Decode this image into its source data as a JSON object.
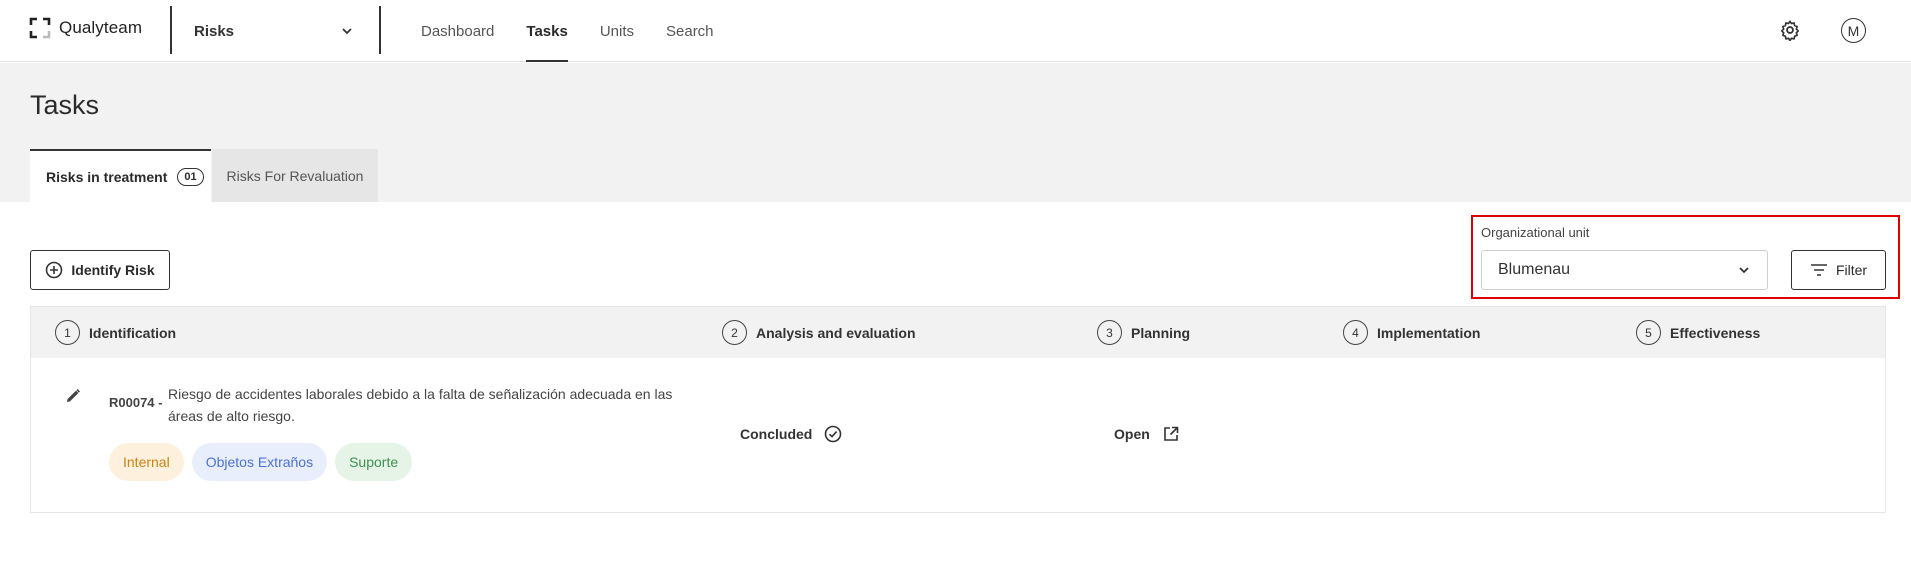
{
  "app": {
    "name": "Qualyteam"
  },
  "module_select": {
    "value": "Risks"
  },
  "nav": [
    {
      "label": "Dashboard",
      "active": false
    },
    {
      "label": "Tasks",
      "active": true
    },
    {
      "label": "Units",
      "active": false
    },
    {
      "label": "Search",
      "active": false
    }
  ],
  "user": {
    "initial": "M"
  },
  "page": {
    "title": "Tasks"
  },
  "tabs": [
    {
      "label": "Risks in treatment",
      "count": "01",
      "active": true
    },
    {
      "label": "Risks For Revaluation",
      "active": false
    }
  ],
  "toolbar": {
    "identify_label": "Identify Risk",
    "org_unit_label": "Organizational unit",
    "org_unit_value": "Blumenau",
    "filter_label": "Filter"
  },
  "table": {
    "columns": [
      {
        "step": "1",
        "label": "Identification"
      },
      {
        "step": "2",
        "label": "Analysis and evaluation"
      },
      {
        "step": "3",
        "label": "Planning"
      },
      {
        "step": "4",
        "label": "Implementation"
      },
      {
        "step": "5",
        "label": "Effectiveness"
      }
    ],
    "rows": [
      {
        "id": "R00074 -",
        "description": "Riesgo de accidentes laborales debido a la falta de señalización adecuada en las áreas de alto riesgo.",
        "tags": [
          "Internal",
          "Objetos Extraños",
          "Suporte"
        ],
        "analysis": "Concluded",
        "planning": "Open"
      }
    ]
  },
  "colors": {
    "highlight": "#e00000",
    "text": "#2b2b2b",
    "band": "#f2f2f2"
  }
}
